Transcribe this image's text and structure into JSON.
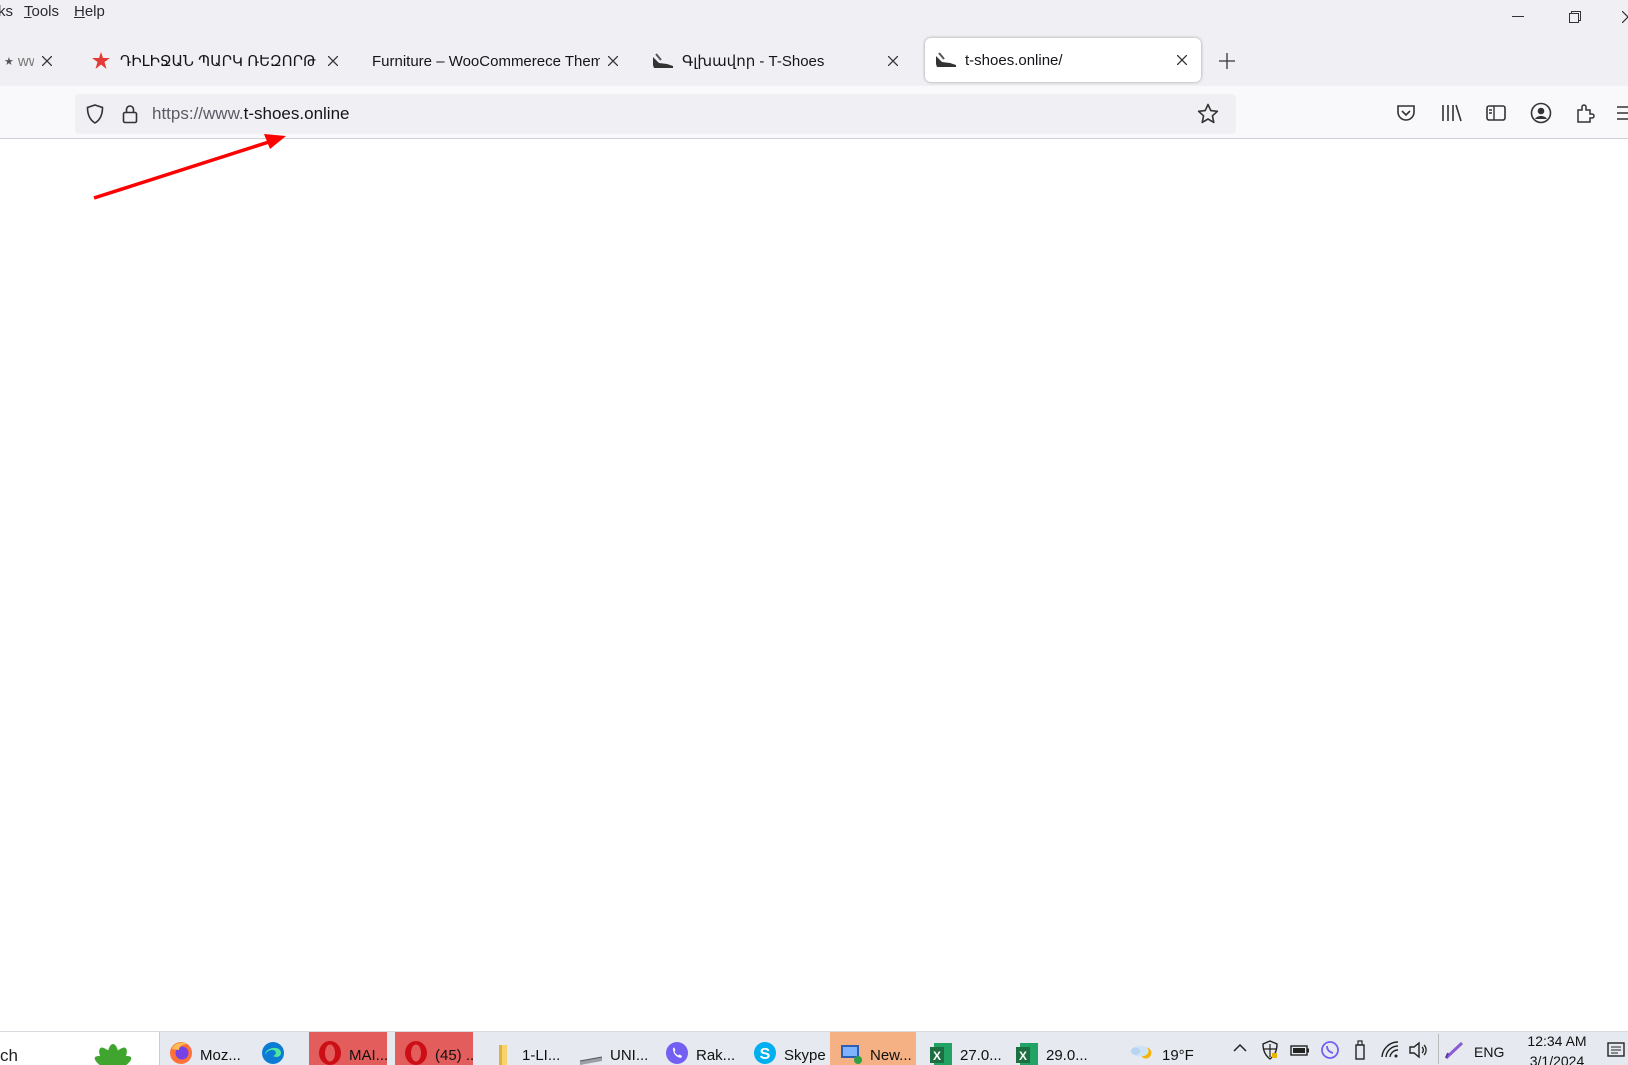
{
  "menu": {
    "items": [
      {
        "prefix": "",
        "accel": "",
        "rest": "ks"
      },
      {
        "prefix": "",
        "accel": "T",
        "rest": "ools"
      },
      {
        "prefix": "",
        "accel": "H",
        "rest": "elp"
      }
    ]
  },
  "window_controls": {
    "minimize": "—",
    "restore": "⧉",
    "close": "✕"
  },
  "tabs": [
    {
      "title": "www",
      "favicon": "star-icon",
      "active": false
    },
    {
      "title": "ԴԻԼԻՋԱՆ ՊԱՐԿ ՌԵԶՈՐԹ ( Դ",
      "favicon": "red-star-icon",
      "active": false
    },
    {
      "title": "Furniture – WooCommerece Theme",
      "favicon": "",
      "active": false
    },
    {
      "title": "Գլխավոր - T-Shoes",
      "favicon": "shoe-icon",
      "active": false
    },
    {
      "title": "t-shoes.online/",
      "favicon": "shoe-icon",
      "active": true
    }
  ],
  "urlbar": {
    "prefix": "https://www.",
    "domain": "t-shoes.online"
  },
  "taskbar": {
    "search_text": "ch",
    "items": [
      {
        "label": "Moz...",
        "icon": "firefox-icon",
        "highlight": ""
      },
      {
        "label": "",
        "icon": "edge-icon",
        "highlight": ""
      },
      {
        "label": "MAI...",
        "icon": "opera-icon",
        "highlight": "red"
      },
      {
        "label": "(45) ...",
        "icon": "opera-icon",
        "highlight": "red"
      },
      {
        "label": "1-LI...",
        "icon": "folder-icon",
        "highlight": ""
      },
      {
        "label": "UNI...",
        "icon": "drive-icon",
        "highlight": ""
      },
      {
        "label": "Rak...",
        "icon": "viber-icon",
        "highlight": ""
      },
      {
        "label": "Skype",
        "icon": "skype-icon",
        "highlight": ""
      },
      {
        "label": "New...",
        "icon": "network-icon",
        "highlight": "orange"
      },
      {
        "label": "27.0...",
        "icon": "excel-icon",
        "highlight": ""
      },
      {
        "label": "29.0...",
        "icon": "excel-icon",
        "highlight": ""
      }
    ],
    "weather": "19°F",
    "lang": "ENG",
    "time": "12:34 AM",
    "date": "3/1/2024"
  },
  "colors": {
    "annotation_arrow": "#ff0000",
    "taskbar_red": "#e45d5d",
    "taskbar_orange": "#f5b183",
    "excel_green": "#1d6f42"
  }
}
